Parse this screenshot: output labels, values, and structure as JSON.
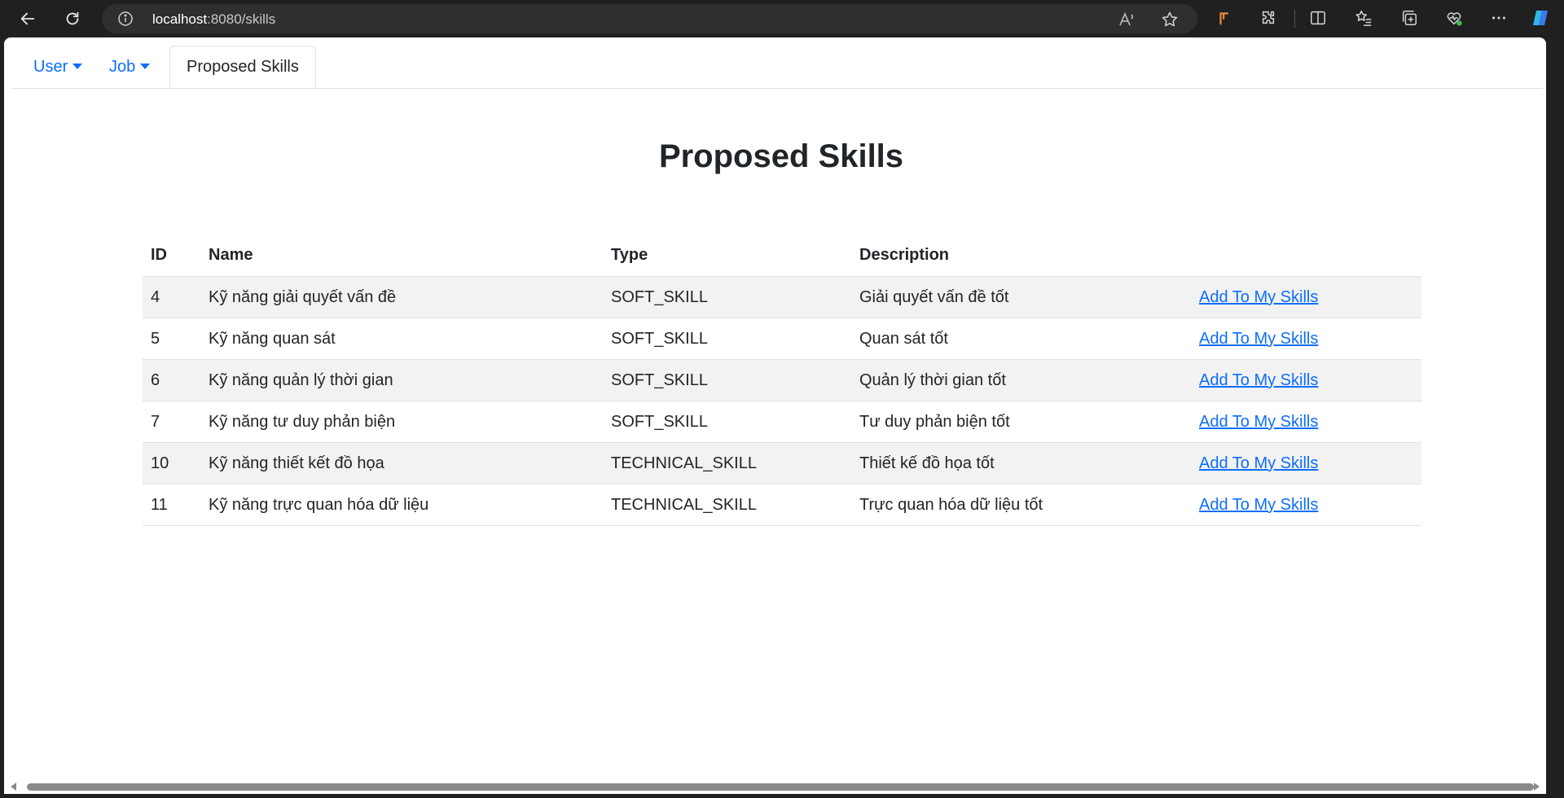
{
  "browser": {
    "url_host": "localhost",
    "url_path": ":8080/skills"
  },
  "nav": {
    "tabs": [
      {
        "label": "User",
        "dropdown": true
      },
      {
        "label": "Job",
        "dropdown": true
      },
      {
        "label": "Proposed Skills",
        "active": true
      }
    ]
  },
  "page": {
    "title": "Proposed Skills"
  },
  "table": {
    "headers": [
      "ID",
      "Name",
      "Type",
      "Description",
      ""
    ],
    "rows": [
      {
        "id": "4",
        "name": "Kỹ năng giải quyết vấn đề",
        "type": "SOFT_SKILL",
        "description": "Giải quyết vấn đề tốt",
        "action": "Add To My Skills"
      },
      {
        "id": "5",
        "name": "Kỹ năng quan sát",
        "type": "SOFT_SKILL",
        "description": "Quan sát tốt",
        "action": "Add To My Skills"
      },
      {
        "id": "6",
        "name": "Kỹ năng quản lý thời gian",
        "type": "SOFT_SKILL",
        "description": "Quản lý thời gian tốt",
        "action": "Add To My Skills"
      },
      {
        "id": "7",
        "name": "Kỹ năng tư duy phản biện",
        "type": "SOFT_SKILL",
        "description": "Tư duy phản biện tốt",
        "action": "Add To My Skills"
      },
      {
        "id": "10",
        "name": "Kỹ năng thiết kết đồ họa",
        "type": "TECHNICAL_SKILL",
        "description": "Thiết kế đồ họa tốt",
        "action": "Add To My Skills"
      },
      {
        "id": "11",
        "name": "Kỹ năng trực quan hóa dữ liệu",
        "type": "TECHNICAL_SKILL",
        "description": "Trực quan hóa dữ liệu tốt",
        "action": "Add To My Skills"
      }
    ]
  },
  "colors": {
    "link": "#0d6efd",
    "text": "#212529",
    "stripe": "#f2f2f2",
    "chrome_bg": "#202020"
  },
  "icons": [
    "back-arrow-icon",
    "refresh-icon",
    "info-icon",
    "read-aloud-icon",
    "favorite-star-icon",
    "extension-orange-icon",
    "extensions-puzzle-icon",
    "split-screen-icon",
    "favorites-icon",
    "collections-icon",
    "browser-essentials-icon",
    "more-icon",
    "copilot-icon"
  ]
}
